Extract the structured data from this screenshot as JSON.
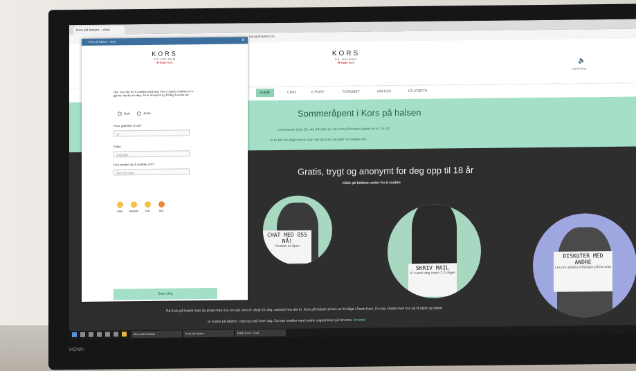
{
  "monitor": {
    "brand": "HDMI"
  },
  "browser": {
    "tab_title": "Kors på halsen – chat",
    "main_url": "korspahalsen.no"
  },
  "site": {
    "logo": {
      "name": "KORS",
      "sub": "PÅ HALSEN",
      "org": "Røde Kors"
    },
    "speaker_label": "Lytt til tekst",
    "nav": [
      "HJEM",
      "CHAT",
      "E-POST",
      "FORUMET",
      "OM OSS",
      "FÅ STØTTE"
    ],
    "notice": {
      "title": "Sommeråpent i Kors på halsen",
      "line1": "I sommeren (uke 25-uke 34) kan du nå Kors på halsen åpent fra kl. 14-20.",
      "line2": "Vi er her for deg hvis du har noe du lurer på eller vil snakke om."
    },
    "hero_title": "Gratis, trygt og anonymt for deg opp til 18 år",
    "hero_hint": "Klikk på bildene under for å snakke",
    "cards": [
      {
        "sign": "CHAT MED OSS NÅ!",
        "caption": "Chatten er åpen"
      },
      {
        "sign": "SKRIV MAIL",
        "caption": "Vi svarer deg innen 2-3 dager"
      },
      {
        "sign": "DISKUTER MED ANDRE",
        "caption": "Les om andres erfaringer på forumet"
      }
    ],
    "footer_line1": "På Kors på halsen kan du prate med oss om det som er viktig for deg, uansett hva det er. Kors på halsen drives av frivillige i Røde Kors. Du kan chatte med oss og få hjelp og støtte.",
    "footer_line2": "Vi svarer på telefon, chat og mail hver dag. Du kan snakke med andre ungdommer på forumet.",
    "footer_link": "forumet"
  },
  "popup": {
    "title": "Kors på halsen – chat",
    "intro": "Hei, vi er her for å snakke med deg. Før vi starter chatten vil vi gjerne vite litt om deg. Alt er anonymt og frivillig å svare på.",
    "gender_options": [
      "Gutt",
      "Jente"
    ],
    "age_label": "Hvor gammel er du?",
    "age_value": "12",
    "county_label": "Fylke",
    "county_value": "Velg fylke",
    "topic_label": "Hva ønsker du å snakke om?",
    "topic_placeholder": "Skriv inn tema",
    "moods": [
      "Glad",
      "Nøytral",
      "Trist",
      "Sint"
    ],
    "start_button": "Start chat"
  },
  "taskbar": {
    "apps": [
      "Microsoft Outlook",
      "Kors på halsen",
      "Røde Kors - Chat"
    ]
  }
}
